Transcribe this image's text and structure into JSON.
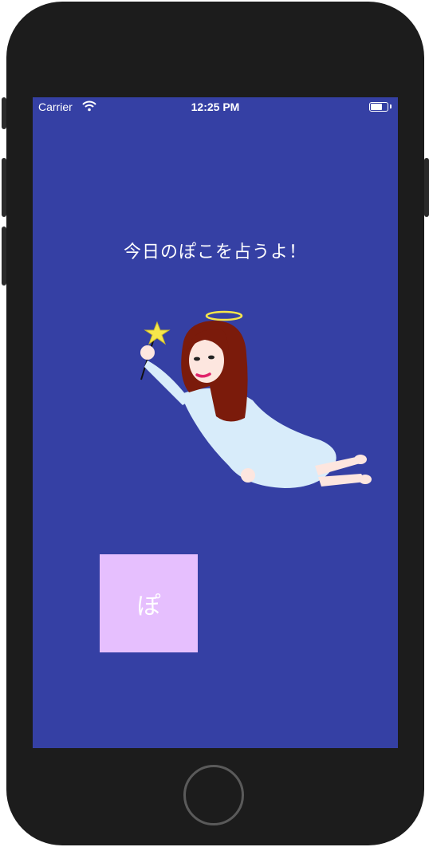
{
  "status_bar": {
    "carrier": "Carrier",
    "time": "12:25 PM",
    "wifi_icon": "wifi-icon",
    "battery_icon": "battery-icon"
  },
  "main": {
    "heading": "今日のぽこを占うよ！",
    "illustration_icon": "angel-with-star-wand-icon",
    "action_button_label": "ぽ"
  },
  "colors": {
    "screen_background": "#3540a4",
    "button_background": "#e6bffe",
    "text": "#ffffff",
    "device_frame": "#1c1c1c"
  }
}
